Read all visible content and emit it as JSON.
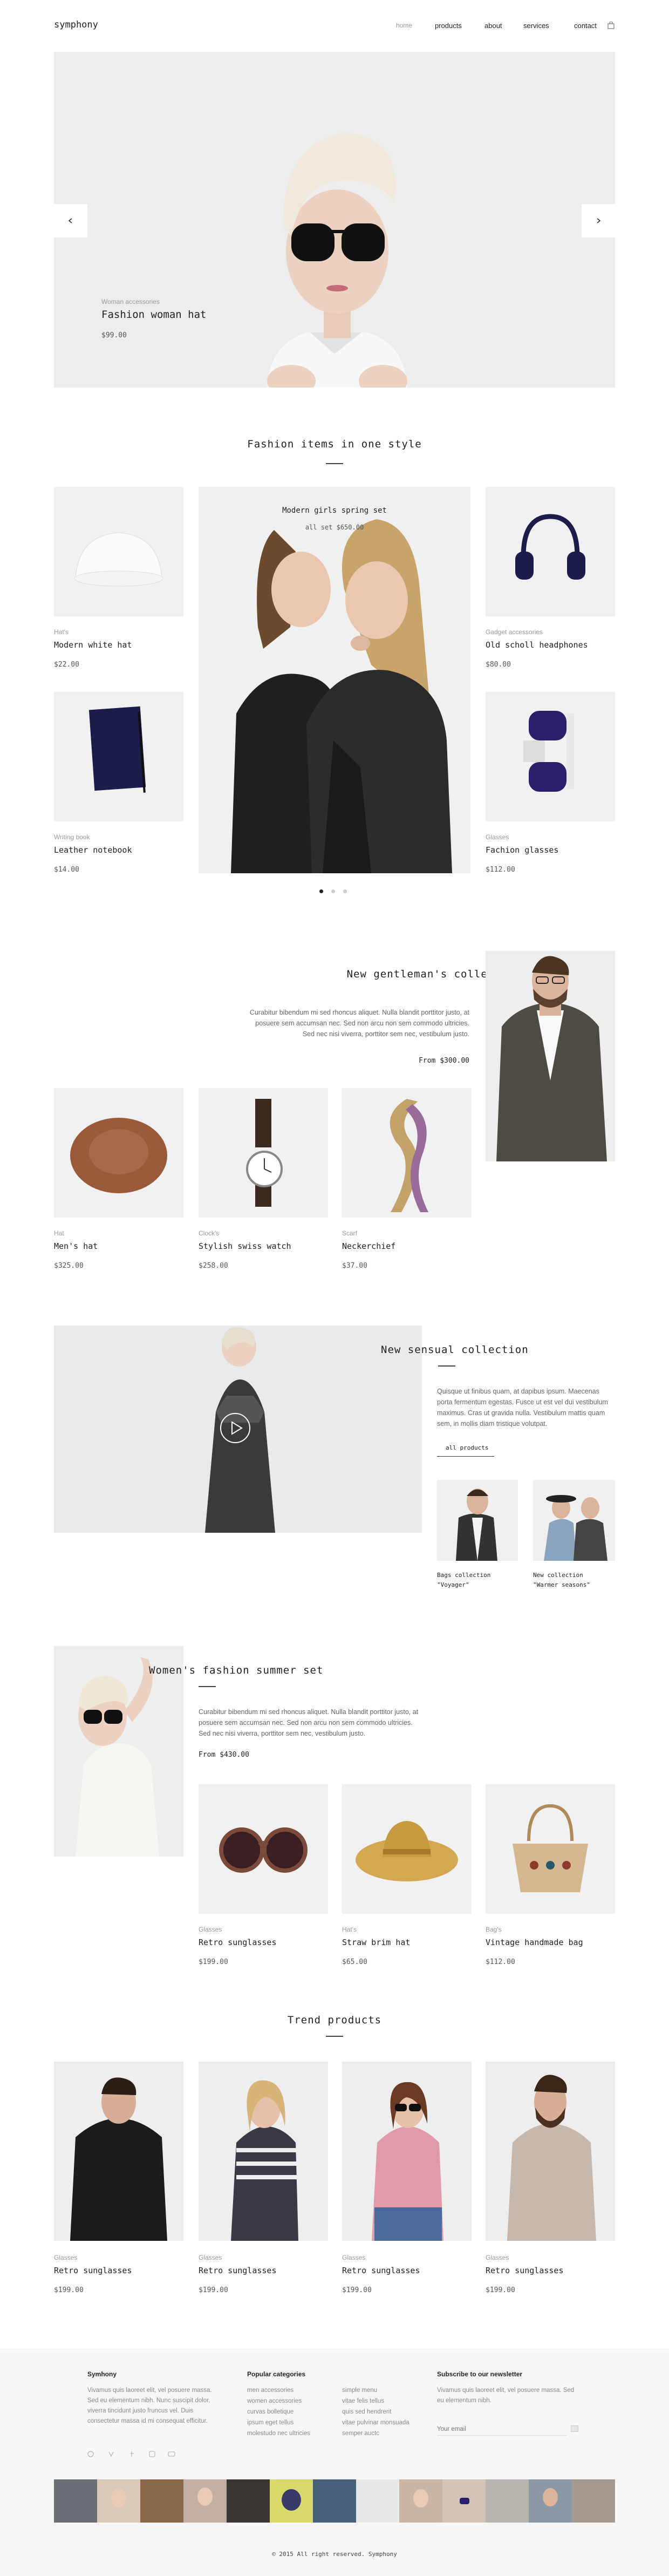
{
  "header": {
    "logo": "symphony",
    "nav": [
      "home",
      "products",
      "about",
      "services",
      "contact"
    ]
  },
  "hero": {
    "category": "Woman accessories",
    "title": "Fashion woman hat",
    "price": "$99.00"
  },
  "section1": {
    "title": "Fashion items in one style",
    "featured_title": "Modern girls spring set",
    "featured_sub": "all set $650.00",
    "products": [
      {
        "category": "Hat's",
        "name": "Modern white hat",
        "price": "$22.00"
      },
      {
        "category": "Gadget accessories",
        "name": "Old scholl headphones",
        "price": "$80.00"
      },
      {
        "category": "Writing book",
        "name": "Leather notebook",
        "price": "$14.00"
      },
      {
        "category": "Glasses",
        "name": "Fachion glasses",
        "price": "$112.00"
      }
    ]
  },
  "section2": {
    "title": "New gentleman's collection",
    "text": "Curabitur bibendum mi sed rhoncus aliquet. Nulla blandit porttitor justo, at posuere sem accumsan nec. Sed non arcu non sem commodo ultricies. Sed nec nisi viverra, porttitor sem nec, vestibulum justo.",
    "price": "From $300.00",
    "products": [
      {
        "category": "Hat",
        "name": "Men's hat",
        "price": "$325.00"
      },
      {
        "category": "Clock's",
        "name": "Stylish swiss watch",
        "price": "$258.00"
      },
      {
        "category": "Scarf",
        "name": "Neckerchief",
        "price": "$37.00"
      }
    ]
  },
  "section3": {
    "title": "New sensual collection",
    "text": "Quisque ut finibus quam, at dapibus ipsum. Maecenas porta fermentum egestas. Fusce ut est vel dui vestibulum maximus. Cras ut gravida nulla. Vestibulum mattis quam sem, in mollis diam tristique volutpat.",
    "link": "all products",
    "thumbs": [
      {
        "line1": "Bags collection",
        "line2": "\"Voyager\""
      },
      {
        "line1": "New collection",
        "line2": "\"Warmer seasons\""
      }
    ]
  },
  "section4": {
    "title": "Women's fashion summer set",
    "text": "Curabitur bibendum mi sed rhoncus aliquet. Nulla blandit porttitor justo, at posuere sem accumsan nec. Sed non arcu non sem commodo ultricies. Sed nec nisi viverra, porttitor sem nec, vestibulum justo.",
    "price": "From $430.00",
    "products": [
      {
        "category": "Glasses",
        "name": "Retro sunglasses",
        "price": "$199.00"
      },
      {
        "category": "Hat's",
        "name": "Straw brim hat",
        "price": "$65.00"
      },
      {
        "category": "Bag's",
        "name": "Vintage handmade bag",
        "price": "$112.00"
      }
    ]
  },
  "trend": {
    "title": "Trend products",
    "products": [
      {
        "category": "Glasses",
        "name": "Retro sunglasses",
        "price": "$199.00"
      },
      {
        "category": "Glasses",
        "name": "Retro sunglasses",
        "price": "$199.00"
      },
      {
        "category": "Glasses",
        "name": "Retro sunglasses",
        "price": "$199.00"
      },
      {
        "category": "Glasses",
        "name": "Retro sunglasses",
        "price": "$199.00"
      }
    ]
  },
  "footer": {
    "col1_title": "Symhony",
    "col1_text": "Vivamus quis laoreet elit, vel posuere massa. Sed eu elementum nibh. Nunc suscipit dolor, viverra tincidunt justo fruncus vel. Duis consectetur massa id mi consequat efficitur.",
    "col2_title": "Popular categories",
    "col2_links_a": [
      "men accessories",
      "women accessories",
      "curvas bolletique",
      "ipsum eget tellus",
      "molestudo nec ultricies"
    ],
    "col2_links_b": [
      "simple menu",
      "vitae felis tellus",
      "quis sed hendrerit",
      "vitae pulvinar monsuada",
      "semper auctc"
    ],
    "col3_title": "Subscribe to our newsletter",
    "col3_text": "Vivamus quis laoreet elit, vel posuere massa. Sed eu elementum nibh.",
    "email_placeholder": "Your email",
    "copyright": "© 2015 All right reserved. Symphony"
  },
  "colors": {
    "accent": "#222222",
    "muted": "#9a9a9a",
    "panel": "#f1f1f1"
  }
}
